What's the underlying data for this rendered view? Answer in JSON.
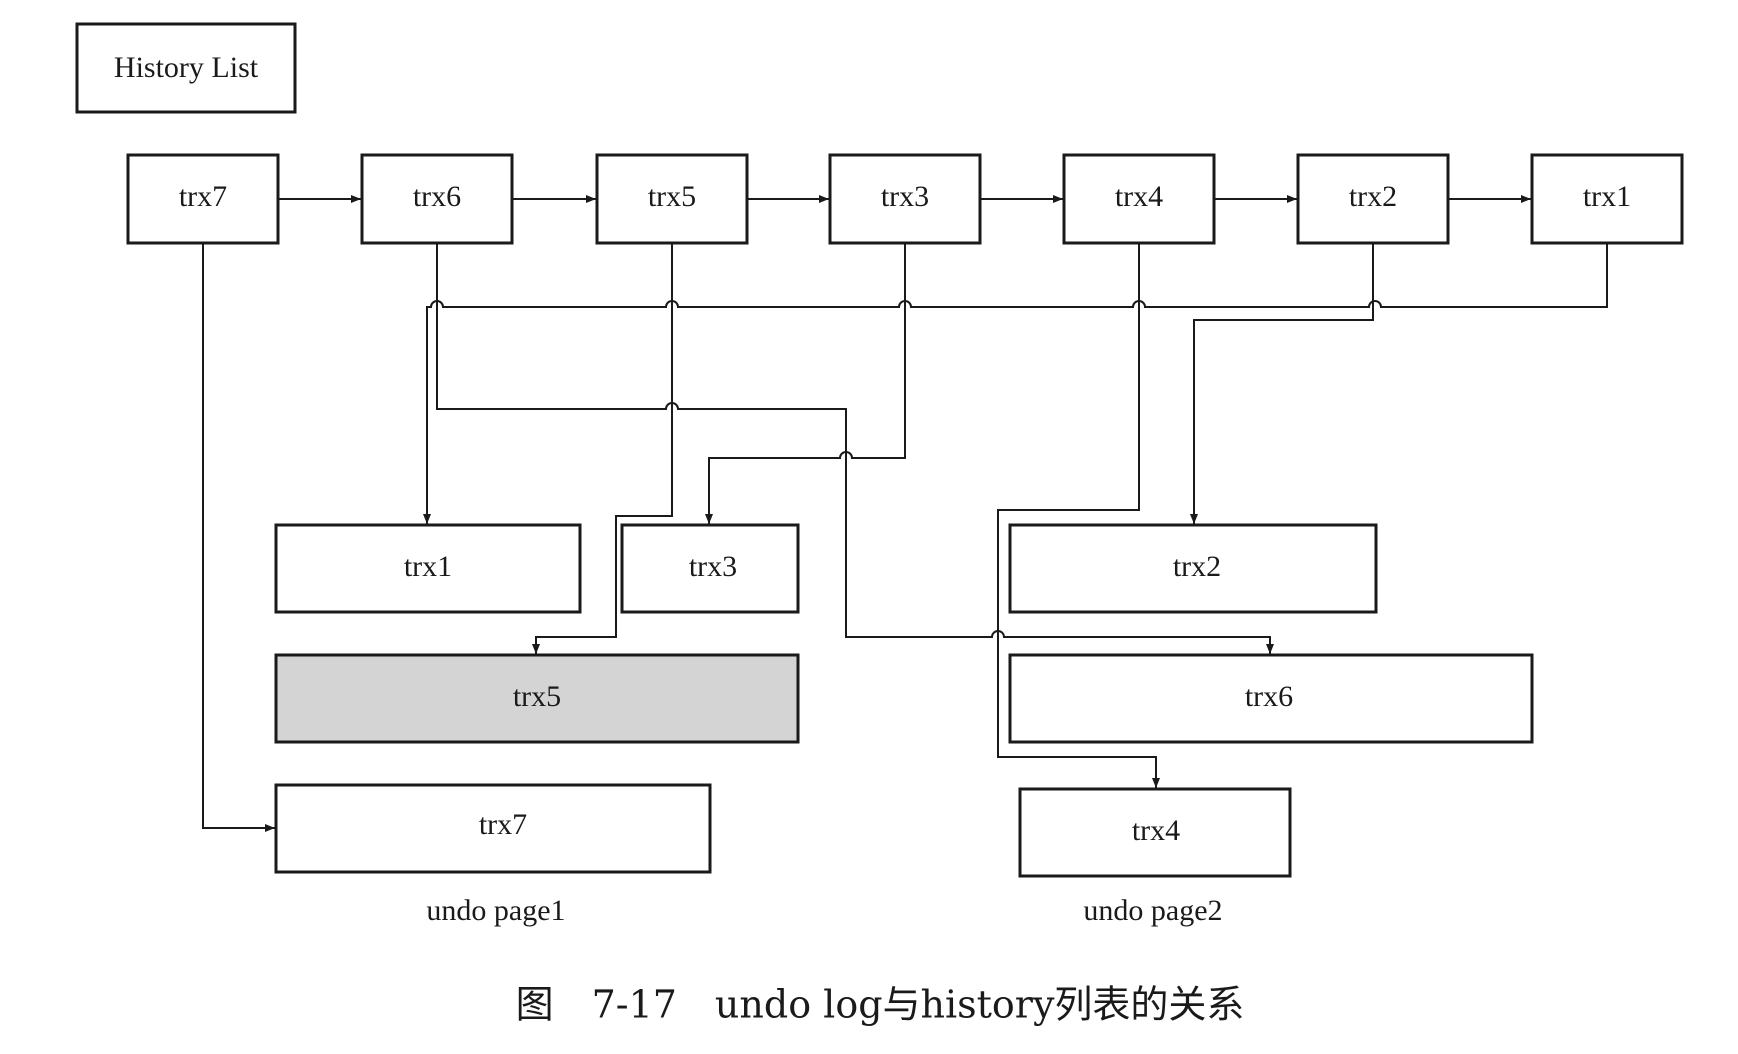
{
  "legend": {
    "history_list_label": "History List"
  },
  "history_list": [
    {
      "id": "h-trx7",
      "label": "trx7"
    },
    {
      "id": "h-trx6",
      "label": "trx6"
    },
    {
      "id": "h-trx5",
      "label": "trx5"
    },
    {
      "id": "h-trx3",
      "label": "trx3"
    },
    {
      "id": "h-trx4",
      "label": "trx4"
    },
    {
      "id": "h-trx2",
      "label": "trx2"
    },
    {
      "id": "h-trx1",
      "label": "trx1"
    }
  ],
  "undo_page1": {
    "caption": "undo page1",
    "entries": [
      {
        "id": "u1-trx1",
        "label": "trx1",
        "highlighted": false
      },
      {
        "id": "u1-trx3",
        "label": "trx3",
        "highlighted": false
      },
      {
        "id": "u1-trx5",
        "label": "trx5",
        "highlighted": true
      },
      {
        "id": "u1-trx7",
        "label": "trx7",
        "highlighted": false
      }
    ]
  },
  "undo_page2": {
    "caption": "undo page2",
    "entries": [
      {
        "id": "u2-trx2",
        "label": "trx2",
        "highlighted": false
      },
      {
        "id": "u2-trx6",
        "label": "trx6",
        "highlighted": false
      },
      {
        "id": "u2-trx4",
        "label": "trx4",
        "highlighted": false
      }
    ]
  },
  "figure": {
    "caption": "图　7-17　undo log与history列表的关系"
  },
  "colors": {
    "stroke": "#1a1a1a",
    "highlight_fill": "#d4d4d4",
    "background": "#ffffff"
  }
}
